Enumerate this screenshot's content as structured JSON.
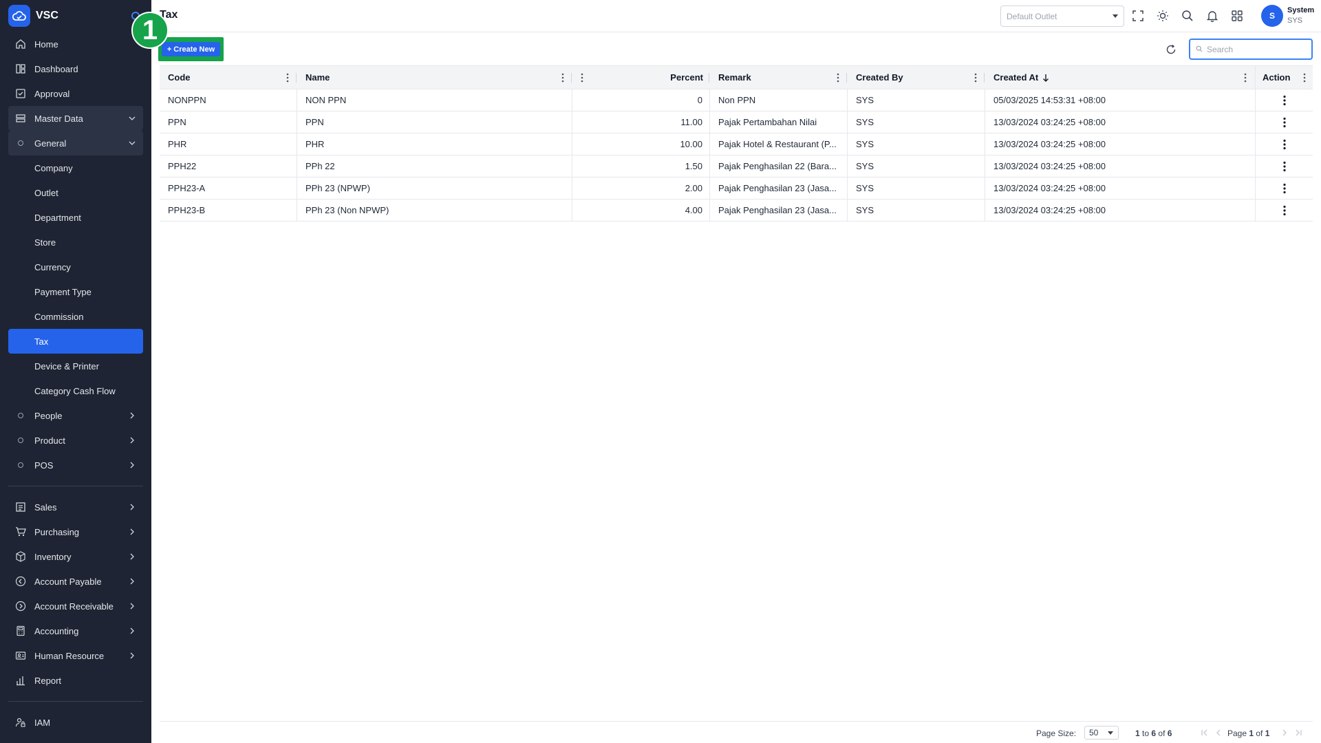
{
  "brand": {
    "name": "VSC"
  },
  "page": {
    "title": "Tax"
  },
  "sidebar": {
    "top_items": [
      {
        "label": "Home",
        "icon": "home-icon"
      },
      {
        "label": "Dashboard",
        "icon": "dashboard-icon"
      },
      {
        "label": "Approval",
        "icon": "approval-icon"
      }
    ],
    "master_data": {
      "label": "Master Data",
      "icon": "master-data-icon"
    },
    "general": {
      "label": "General"
    },
    "general_items": [
      "Company",
      "Outlet",
      "Department",
      "Store",
      "Currency",
      "Payment Type",
      "Commission",
      "Tax",
      "Device & Printer",
      "Category Cash Flow"
    ],
    "active_item": "Tax",
    "groups": [
      "People",
      "Product",
      "POS"
    ],
    "modules": [
      {
        "label": "Sales",
        "icon": "sales-icon"
      },
      {
        "label": "Purchasing",
        "icon": "cart-icon"
      },
      {
        "label": "Inventory",
        "icon": "box-icon"
      },
      {
        "label": "Account Payable",
        "icon": "arrow-left-circle-icon"
      },
      {
        "label": "Account Receivable",
        "icon": "arrow-right-circle-icon"
      },
      {
        "label": "Accounting",
        "icon": "calculator-icon"
      },
      {
        "label": "Human Resource",
        "icon": "id-card-icon"
      }
    ],
    "report": {
      "label": "Report",
      "icon": "report-icon"
    },
    "iam": {
      "label": "IAM",
      "icon": "user-lock-icon"
    }
  },
  "topbar": {
    "outlet_placeholder": "Default Outlet",
    "icons": [
      "fullscreen-icon",
      "theme-icon",
      "search-icon",
      "bell-icon",
      "apps-icon"
    ],
    "user": {
      "initial": "S",
      "name": "System",
      "code": "SYS"
    }
  },
  "toolbar": {
    "create_label": "Create New",
    "step_number": "1",
    "search_placeholder": "Search"
  },
  "table": {
    "columns": [
      "Code",
      "Name",
      "",
      "Percent",
      "Remark",
      "Created By",
      "Created At",
      "Action"
    ],
    "sort": {
      "column": "Created At",
      "direction": "desc"
    },
    "rows": [
      {
        "code": "NONPPN",
        "name": "NON PPN",
        "percent": "0",
        "remark": "Non PPN",
        "created_by": "SYS",
        "created_at": "05/03/2025 14:53:31 +08:00"
      },
      {
        "code": "PPN",
        "name": "PPN",
        "percent": "11.00",
        "remark": "Pajak Pertambahan Nilai",
        "created_by": "SYS",
        "created_at": "13/03/2024 03:24:25 +08:00"
      },
      {
        "code": "PHR",
        "name": "PHR",
        "percent": "10.00",
        "remark": "Pajak Hotel & Restaurant (P...",
        "created_by": "SYS",
        "created_at": "13/03/2024 03:24:25 +08:00"
      },
      {
        "code": "PPH22",
        "name": "PPh 22",
        "percent": "1.50",
        "remark": "Pajak Penghasilan 22 (Bara...",
        "created_by": "SYS",
        "created_at": "13/03/2024 03:24:25 +08:00"
      },
      {
        "code": "PPH23-A",
        "name": "PPh 23 (NPWP)",
        "percent": "2.00",
        "remark": "Pajak Penghasilan 23 (Jasa...",
        "created_by": "SYS",
        "created_at": "13/03/2024 03:24:25 +08:00"
      },
      {
        "code": "PPH23-B",
        "name": "PPh 23 (Non NPWP)",
        "percent": "4.00",
        "remark": "Pajak Penghasilan 23 (Jasa...",
        "created_by": "SYS",
        "created_at": "13/03/2024 03:24:25 +08:00"
      }
    ]
  },
  "pagination": {
    "page_size_label": "Page Size:",
    "page_size": "50",
    "range_from": "1",
    "range_to": "6",
    "total": "6",
    "page_current": "1",
    "page_total": "1"
  },
  "colors": {
    "sidebar_bg": "#1e2433",
    "accent": "#2563eb",
    "highlight": "#16a34a"
  }
}
